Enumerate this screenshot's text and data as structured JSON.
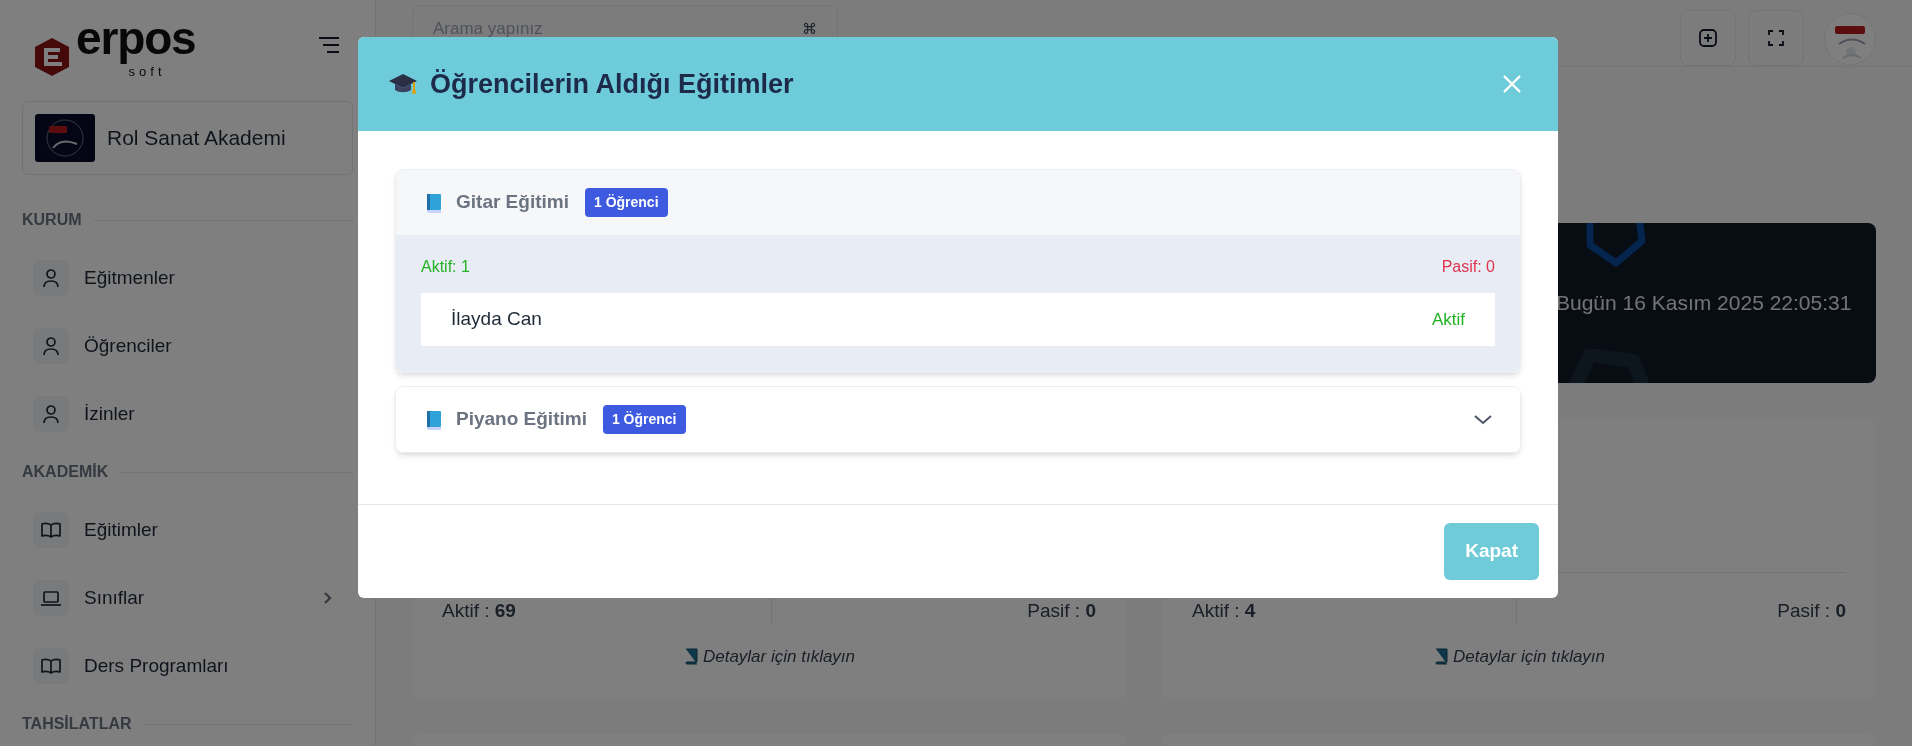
{
  "sidebar": {
    "logo": {
      "text": "erpos",
      "subtext": "soft"
    },
    "organization": {
      "name": "Rol Sanat Akademi"
    },
    "sections": [
      {
        "title": "KURUM",
        "items": [
          {
            "label": "Eğitmenler",
            "kind": "person",
            "has_submenu": false
          },
          {
            "label": "Öğrenciler",
            "kind": "person",
            "has_submenu": false
          },
          {
            "label": "İzinler",
            "kind": "person",
            "has_submenu": false
          }
        ]
      },
      {
        "title": "AKADEMİK",
        "items": [
          {
            "label": "Eğitimler",
            "kind": "book",
            "has_submenu": false
          },
          {
            "label": "Sınıflar",
            "kind": "laptop",
            "has_submenu": true
          },
          {
            "label": "Ders Programları",
            "kind": "book",
            "has_submenu": false
          }
        ]
      },
      {
        "title": "TAHSİLATLAR"
      }
    ]
  },
  "topbar": {
    "search": {
      "placeholder": "Arama yapınız",
      "shortcut": "⌘"
    }
  },
  "banner": {
    "text": "Bugün 16 Kasım 2025 22:05:31"
  },
  "stat_cards": [
    {
      "active": "Aktif : **69**",
      "passive": "Pasif : **0**",
      "link": "Detaylar için tıklayın"
    },
    {
      "active": "Aktif : **4**",
      "passive": "Pasif : **0**",
      "link": "Detaylar için tıklayın"
    }
  ],
  "modal": {
    "title": "Öğrencilerin Aldığı Eğitimler",
    "courses": [
      {
        "name": "Gitar Eğitimi",
        "badge": "1 Öğrenci",
        "expanded": true,
        "active_count": "Aktif: 1",
        "passive_count": "Pasif: 0",
        "students": [
          {
            "name": "İlayda Can",
            "status": "Aktif",
            "kind": "active"
          }
        ]
      },
      {
        "name": "Piyano Eğitimi",
        "badge": "1 Öğrenci",
        "expanded": false
      }
    ],
    "close_button": "Kapat"
  }
}
